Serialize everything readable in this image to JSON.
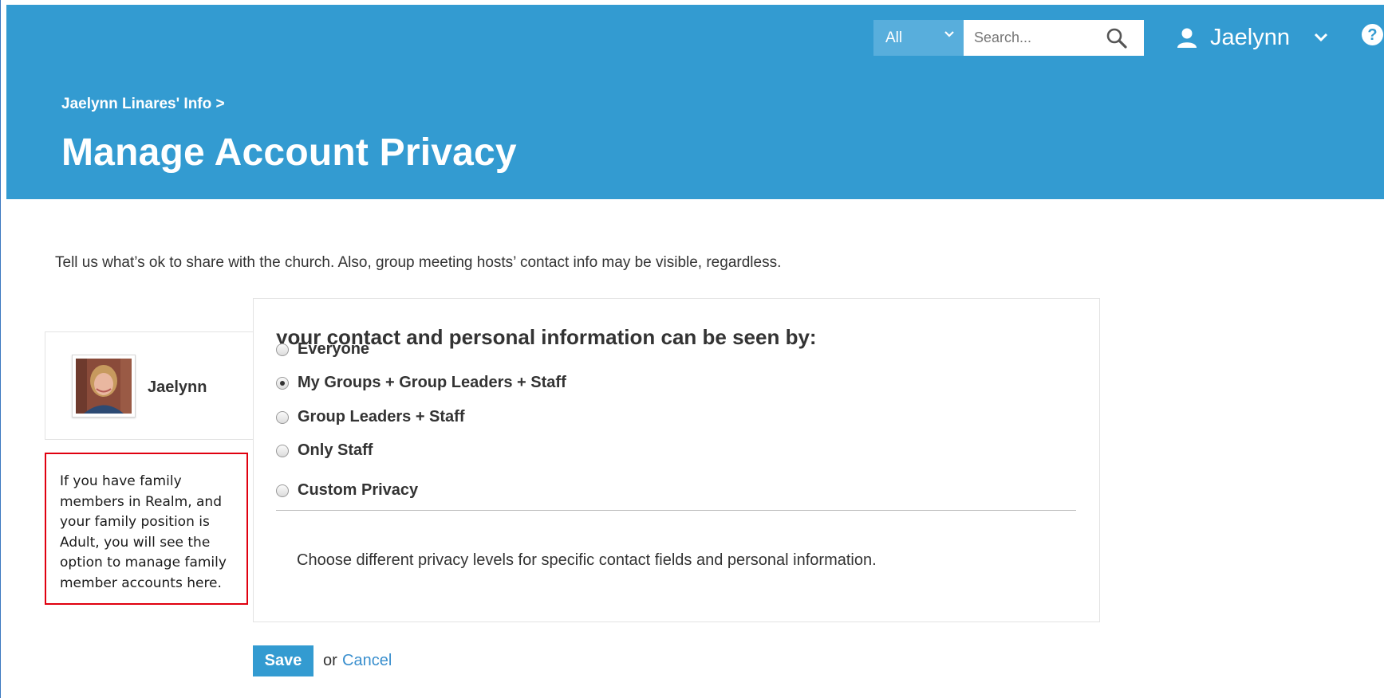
{
  "header": {
    "scope_select": {
      "value": "All"
    },
    "search": {
      "placeholder": "Search..."
    },
    "user_menu": {
      "name": "Jaelynn"
    },
    "help_icon": "question-circle-icon",
    "breadcrumb": "Jaelynn Linares' Info >",
    "title": "Manage Account Privacy"
  },
  "main": {
    "intro": "Tell us what’s ok to share with the church. Also, group meeting hosts’ contact info may be visible, regardless.",
    "member": {
      "name": "Jaelynn"
    },
    "note": "If you have family members in Realm, and your family position is Adult, you will see the option to manage family member accounts here.",
    "privacy": {
      "heading": "your contact and personal information can be seen by:",
      "options": [
        {
          "label": "Everyone",
          "checked": false
        },
        {
          "label": "My Groups + Group Leaders + Staff",
          "checked": true
        },
        {
          "label": "Group Leaders + Staff",
          "checked": false
        },
        {
          "label": "Only Staff",
          "checked": false
        },
        {
          "label": "Custom Privacy",
          "checked": false
        }
      ],
      "custom_description": "Choose different privacy levels for specific contact fields and personal information."
    },
    "actions": {
      "save_label": "Save",
      "or_text": "or",
      "cancel_label": "Cancel"
    }
  },
  "colors": {
    "header_bg": "#339bd1",
    "note_border": "#e0000f",
    "link": "#3a8fce"
  }
}
